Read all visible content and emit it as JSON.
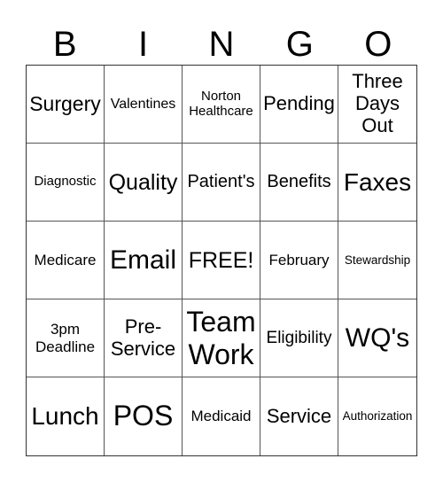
{
  "header": [
    "B",
    "I",
    "N",
    "G",
    "O"
  ],
  "cells": [
    "Surgery",
    "Valentines",
    "Norton Healthcare",
    "Pending",
    "Three Days Out",
    "Diagnostic",
    "Quality",
    "Patient's",
    "Benefits",
    "Faxes",
    "Medicare",
    "Email",
    "FREE!",
    "February",
    "Stewardship",
    "3pm Deadline",
    "Pre-Service",
    "Team Work",
    "Eligibility",
    "WQ's",
    "Lunch",
    "POS",
    "Medicaid",
    "Service",
    "Authorization"
  ]
}
